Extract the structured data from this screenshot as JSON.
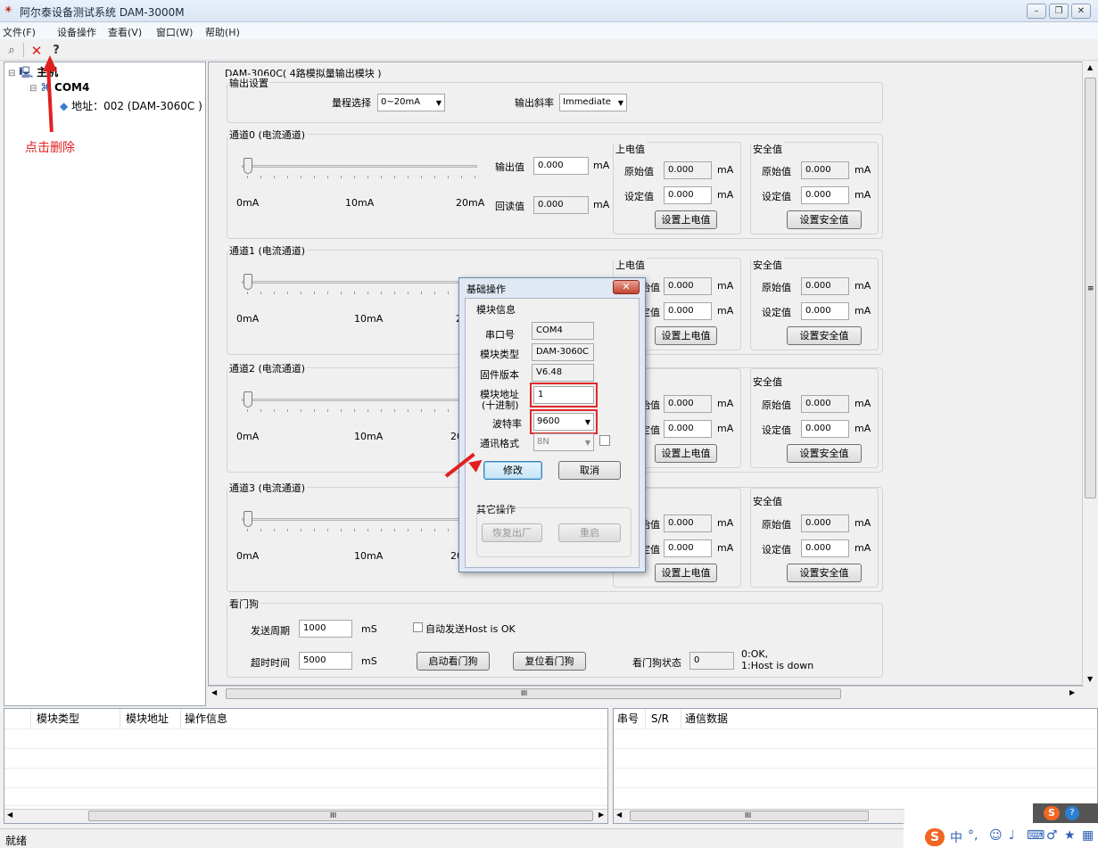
{
  "window": {
    "title": "阿尔泰设备测试系统 DAM-3000M"
  },
  "menu": [
    "文件(F)",
    "设备操作",
    "查看(V)",
    "窗口(W)",
    "帮助(H)"
  ],
  "tree": {
    "root": "主机",
    "port": "COM4",
    "device": "地址：002 (DAM-3060C )"
  },
  "annotation": {
    "delete_note": "点击删除"
  },
  "module": {
    "title": "DAM-3060C( 4路模拟量输出模块 )",
    "output_settings": {
      "title": "输出设置",
      "range_label": "量程选择",
      "range_value": "0~20mA",
      "slope_label": "输出斜率",
      "slope_value": "Immediate"
    },
    "channels": [
      {
        "title": "通道0 (电流通道)",
        "output_value": "0.000",
        "readback_value": "0.000"
      },
      {
        "title": "通道1 (电流通道)"
      },
      {
        "title": "通道2 (电流通道)"
      },
      {
        "title": "通道3 (电流通道)"
      }
    ],
    "channel_common": {
      "min_label": "0mA",
      "mid_label": "10mA",
      "max_label": "20mA",
      "output_label": "输出值",
      "readback_label": "回读值",
      "unit": "mA",
      "power_on_title": "上电值",
      "safe_title": "安全值",
      "raw_label": "原始值",
      "set_label": "设定值",
      "raw_value": "0.000",
      "set_value": "0.000",
      "set_power_on_button": "设置上电值",
      "set_safe_button": "设置安全值",
      "power_on_title_clipped": "值",
      "raw_label_clipped": "始值",
      "set_label_clipped": "定值",
      "max_label_clipped": "20"
    },
    "watchdog": {
      "title": "看门狗",
      "period_label": "发送周期",
      "period_value": "1000",
      "period_unit": "mS",
      "auto_send_label": "自动发送Host is OK",
      "timeout_label": "超时时间",
      "timeout_value": "5000",
      "timeout_unit": "mS",
      "start_button": "启动看门狗",
      "reset_button": "复位看门狗",
      "status_label": "看门狗状态",
      "status_value": "0",
      "status_legend_1": "0:OK,",
      "status_legend_2": "1:Host is down"
    }
  },
  "dialog": {
    "title": "基础操作",
    "close": "✕",
    "info_title": "模块信息",
    "port_label": "串口号",
    "port_value": "COM4",
    "type_label": "模块类型",
    "type_value": "DAM-3060C",
    "fw_label": "固件版本",
    "fw_value": "V6.48",
    "addr_label_1": "模块地址",
    "addr_label_2": "(十进制)",
    "addr_value": "1",
    "baud_label": "波特率",
    "baud_value": "9600",
    "format_label": "通讯格式",
    "format_value": "8N",
    "modify_button": "修改",
    "cancel_button": "取消",
    "other_title": "其它操作",
    "factory_button": "恢复出厂",
    "restart_button": "重启"
  },
  "log_left": {
    "columns": [
      "模块类型",
      "模块地址",
      "操作信息"
    ]
  },
  "log_right": {
    "columns": [
      "串号",
      "S/R",
      "通信数据"
    ]
  },
  "scroll_marker": "III",
  "status": {
    "text": "就绪"
  },
  "colors": {
    "accent_red": "#e02020",
    "selection": "#3399ff"
  }
}
